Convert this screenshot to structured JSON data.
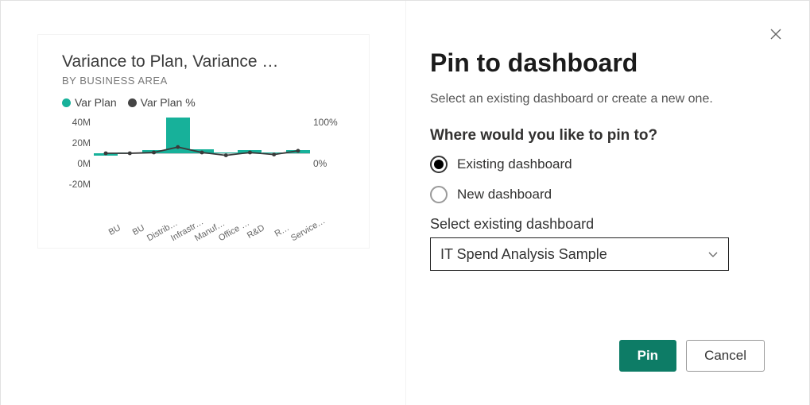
{
  "dialog": {
    "title": "Pin to dashboard",
    "subtitle": "Select an existing dashboard or create a new one.",
    "question": "Where would you like to pin to?",
    "option_existing": "Existing dashboard",
    "option_new": "New dashboard",
    "select_label": "Select existing dashboard",
    "select_value": "IT Spend Analysis Sample",
    "pin": "Pin",
    "cancel": "Cancel",
    "close_icon": "close-icon",
    "chevron_icon": "chevron-down-icon"
  },
  "tile": {
    "title": "Variance to Plan, Variance …",
    "subtitle": "BY BUSINESS AREA",
    "legend_a": "Var Plan",
    "legend_b": "Var Plan %",
    "ylabels_left": [
      "40M",
      "20M",
      "0M",
      "-20M"
    ],
    "ylabels_right": [
      "100%",
      "0%"
    ]
  },
  "colors": {
    "accent": "#17b19a",
    "primary_button": "#0d7c66"
  },
  "chart_data": {
    "type": "bar+line",
    "categories": [
      "BU",
      "BU",
      "Distrib…",
      "Infrastr…",
      "Manuf…",
      "Office …",
      "R&D",
      "R…",
      "Service…"
    ],
    "series": [
      {
        "name": "Var Plan",
        "axis": "left",
        "type": "bar",
        "values": [
          -2,
          1,
          3,
          35,
          4,
          0,
          3,
          1,
          3
        ]
      },
      {
        "name": "Var Plan %",
        "axis": "right",
        "type": "line",
        "values": [
          0,
          0,
          2,
          15,
          2,
          -5,
          2,
          -3,
          6
        ]
      }
    ],
    "y_left": {
      "min": -20,
      "max": 40,
      "unit": "M"
    },
    "y_right": {
      "min": 0,
      "max": 100,
      "unit": "%"
    },
    "title": "Variance to Plan, Variance …",
    "subtitle": "BY BUSINESS AREA"
  }
}
